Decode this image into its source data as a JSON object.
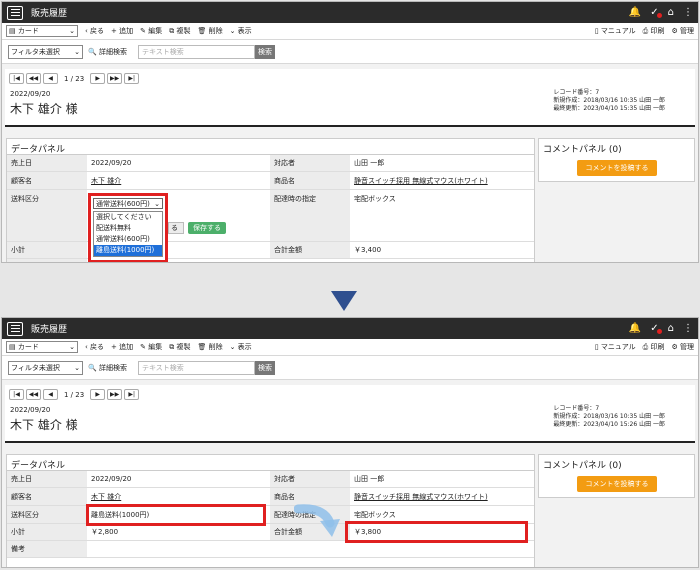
{
  "app": {
    "title": "販売履歴"
  },
  "toolbar": {
    "view": "カード",
    "back": "戻る",
    "add": "追加",
    "edit": "編集",
    "copy": "複製",
    "delete": "削除",
    "display": "表示",
    "manual": "マニュアル",
    "print": "印刷",
    "manage": "管理"
  },
  "filter": {
    "selected": "フィルタ未選択",
    "advanced": "詳細検索",
    "placeholder": "テキスト検索",
    "search_btn": "検索"
  },
  "pager": {
    "text": "1 / 23"
  },
  "record": {
    "date": "2022/09/20",
    "name": "木下 雄介 様",
    "record_no": "レコード番号：7",
    "created": "新規作成：2018/03/16 10:35 山田 一郎",
    "updated_before": "最終更新：2023/04/10 15:35 山田 一郎",
    "updated_after": "最終更新：2023/04/10 15:26 山田 一郎"
  },
  "panel": {
    "title": "データパネル"
  },
  "labels": {
    "sales_date": "売上日",
    "customer": "顧客名",
    "shipping": "送料区分",
    "subtotal": "小計",
    "notes": "備考",
    "staff": "対応者",
    "product": "商品名",
    "delivery": "配達時の指定",
    "total": "合計金額"
  },
  "values": {
    "sales_date": "2022/09/20",
    "customer": "木下 雄介",
    "staff": "山田 一郎",
    "product": "静音スイッチ採用 無線式マウス(ホワイト)",
    "delivery": "宅配ボックス",
    "subtotal_before": "",
    "total_before": "￥3,400",
    "shipping_after": "離島送料(1000円)",
    "subtotal_after": "￥2,800",
    "total_after": "￥3,800"
  },
  "dropdown": {
    "selected": "通常送料(600円)",
    "options": [
      "選択してください",
      "配送料無料",
      "通常送料(600円)",
      "離島送料(1000円)"
    ],
    "save": "保存する",
    "cancel_fragment": "る"
  },
  "comment": {
    "title": "コメントパネル (0)",
    "button": "コメントを投稿する"
  },
  "colors": {
    "highlight": "#e02020",
    "accent": "#f39c12",
    "save": "#4caf6a",
    "selection": "#1e6fd9"
  }
}
